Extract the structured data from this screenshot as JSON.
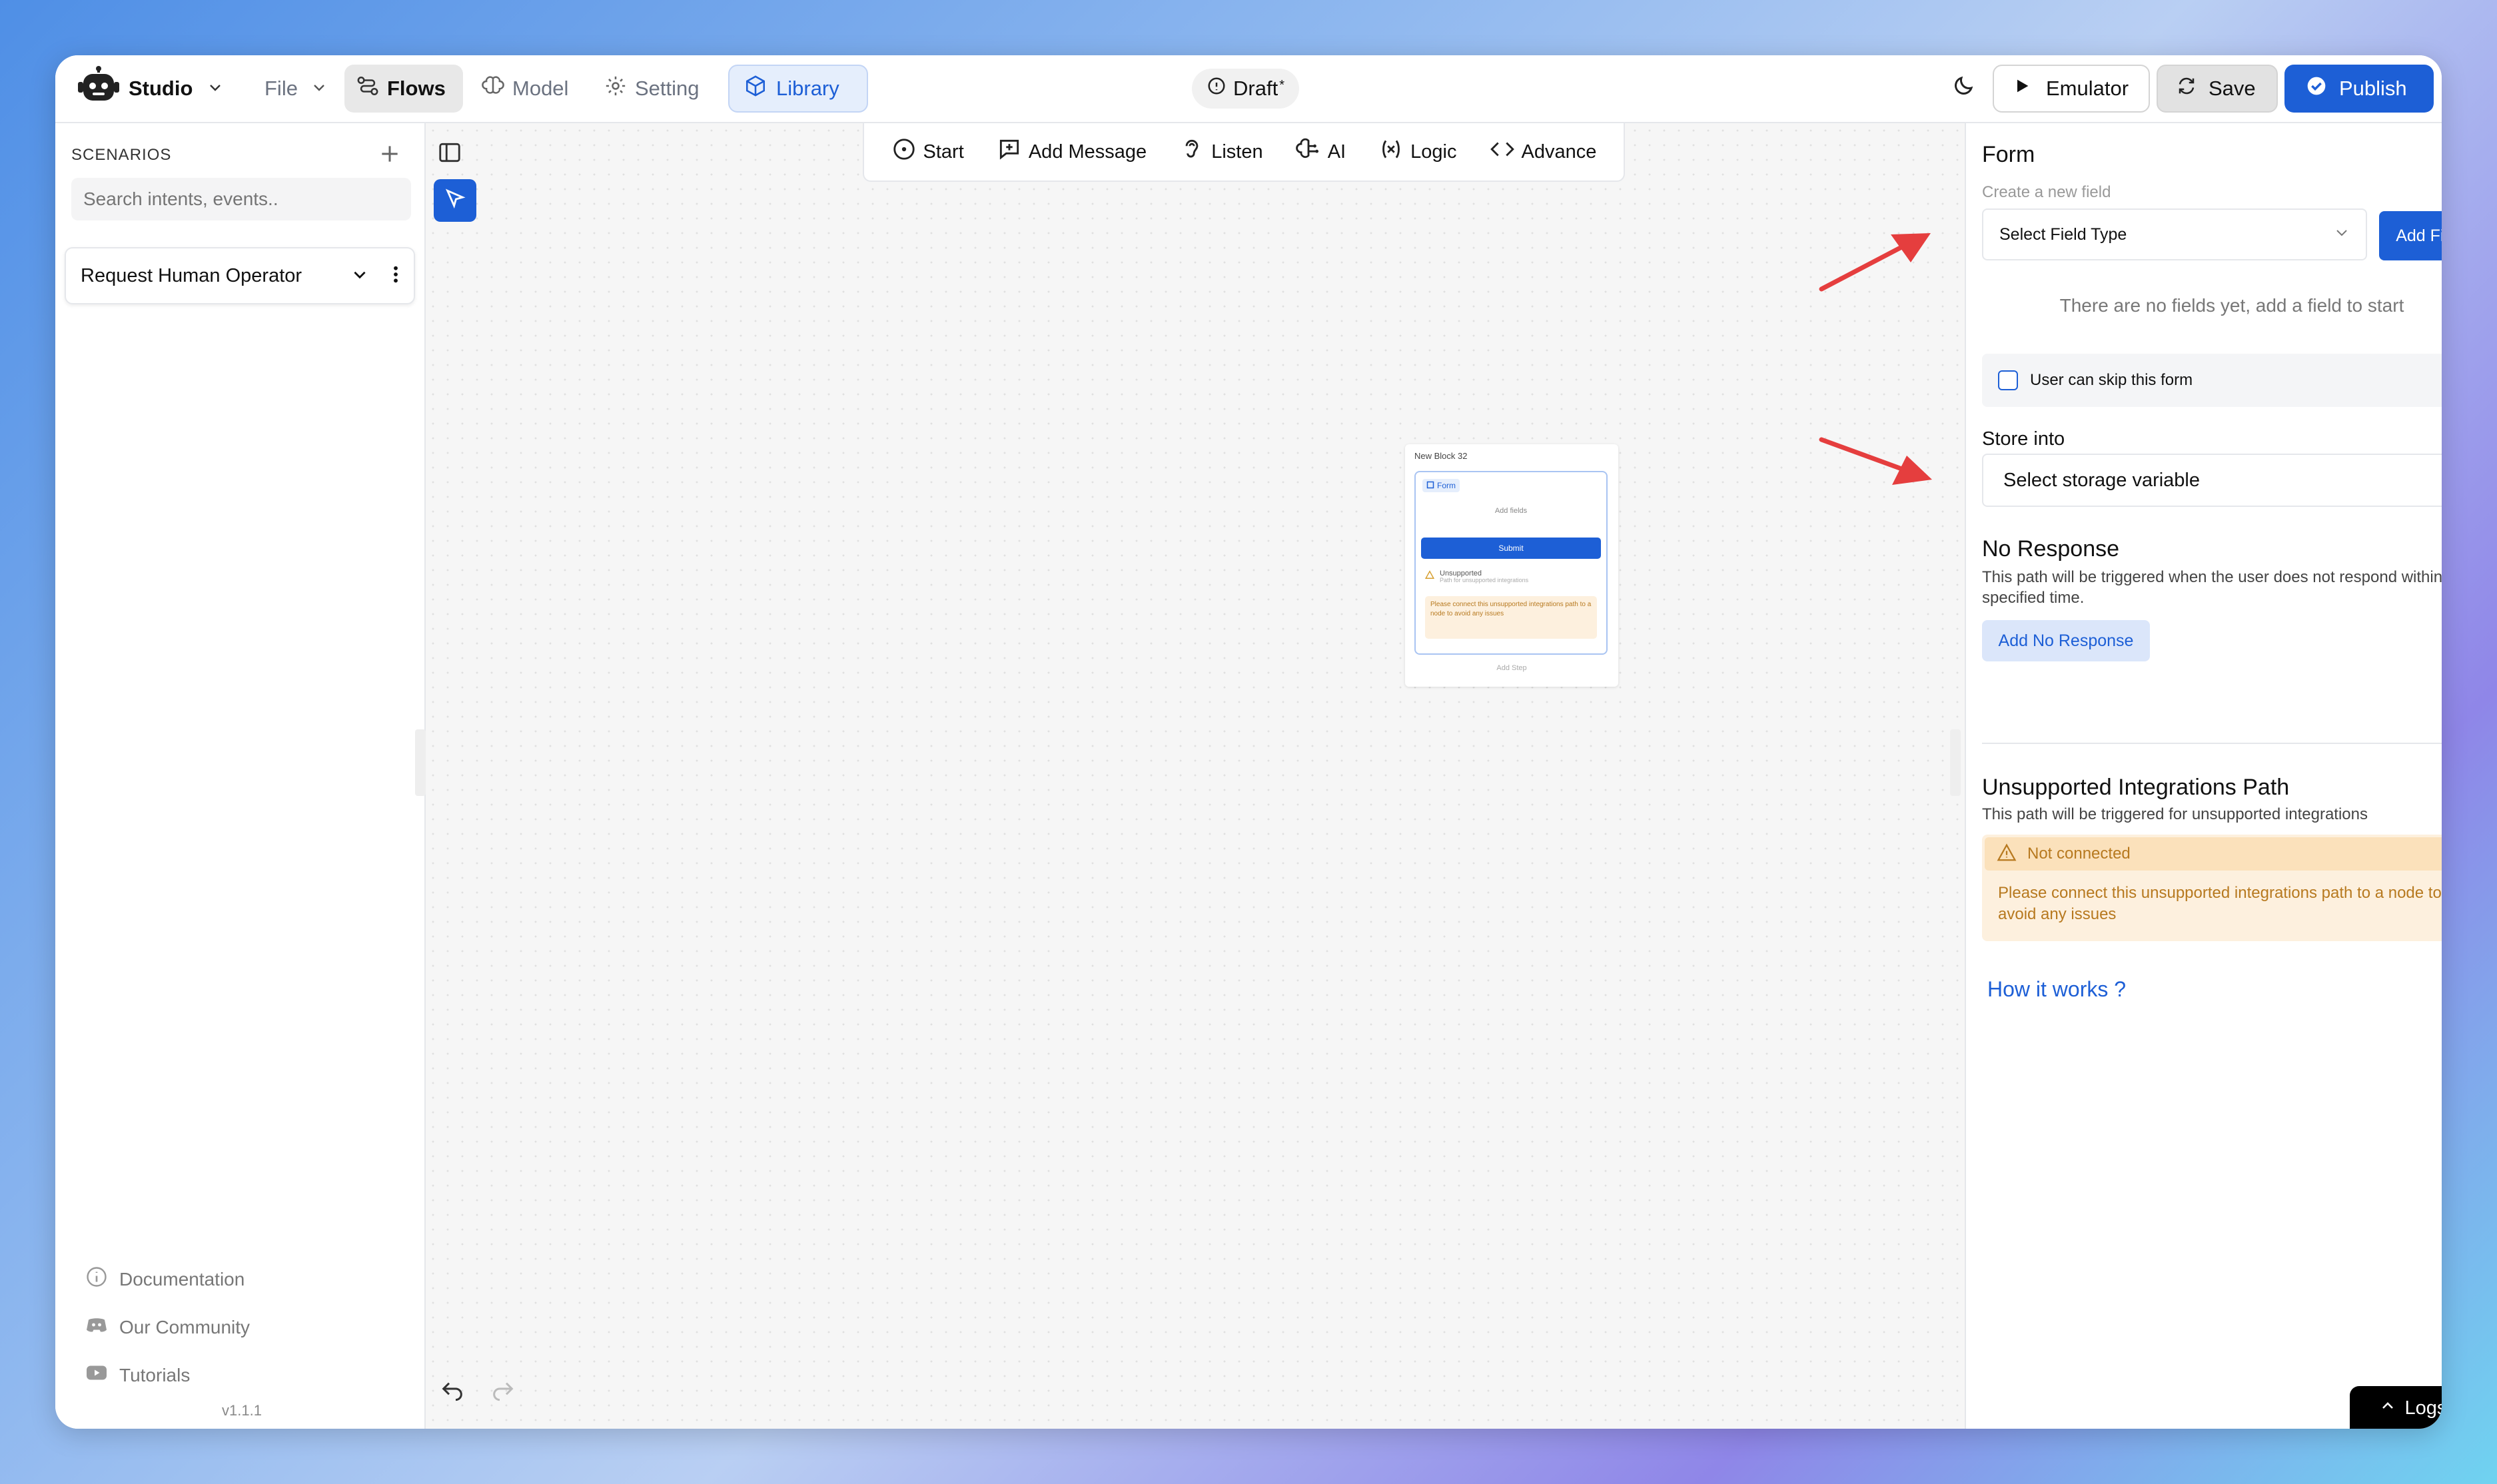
{
  "app": {
    "name": "Studio"
  },
  "nav": {
    "file": "File",
    "flows": "Flows",
    "model": "Model",
    "setting": "Setting",
    "library": "Library"
  },
  "status": {
    "draft": "Draft",
    "draft_marker": "*"
  },
  "actions": {
    "emulator": "Emulator",
    "save": "Save",
    "publish": "Publish"
  },
  "sidebar": {
    "section_title": "SCENARIOS",
    "search_placeholder": "Search intents, events..",
    "scenarios": [
      {
        "label": "Request Human Operator"
      }
    ],
    "footer_links": [
      {
        "label": "Documentation"
      },
      {
        "label": "Our Community"
      },
      {
        "label": "Tutorials"
      }
    ],
    "version": "v1.1.1"
  },
  "canvas_toolbar": {
    "start": "Start",
    "add_message": "Add Message",
    "listen": "Listen",
    "ai": "AI",
    "logic": "Logic",
    "advance": "Advance"
  },
  "node": {
    "title": "New Block 32",
    "form_tag": "Form",
    "add_fields": "Add fields",
    "submit": "Submit",
    "unsupported_title": "Unsupported",
    "unsupported_sub": "Path for unsupported integrations",
    "warning": "Please connect this unsupported integrations path to a node to avoid any issues",
    "add_step": "Add Step"
  },
  "panel": {
    "title": "Form",
    "create_label": "Create a new field",
    "select_field_type": "Select Field Type",
    "add_field": "Add Field",
    "empty": "There are no fields yet, add a field to start",
    "skip_label": "User can skip this form",
    "store_into": "Store into",
    "storage_placeholder": "Select storage variable",
    "no_response_title": "No Response",
    "no_response_desc": "This path will be triggered when the user does not respond within the specified time.",
    "add_no_response": "Add No Response",
    "unsupported_title": "Unsupported Integrations Path",
    "unsupported_desc": "This path will be triggered for unsupported integrations",
    "not_connected": "Not connected",
    "warning": "Please connect this unsupported integrations path to a node to avoid any issues",
    "how_it_works": "How it works ?"
  },
  "logs": "Logs",
  "colors": {
    "primary": "#1d5fd6",
    "library_bg": "#e5eefc",
    "warning_bg": "#fdf0de",
    "warning_text": "#b7791f",
    "arrow": "#e53e3e"
  }
}
